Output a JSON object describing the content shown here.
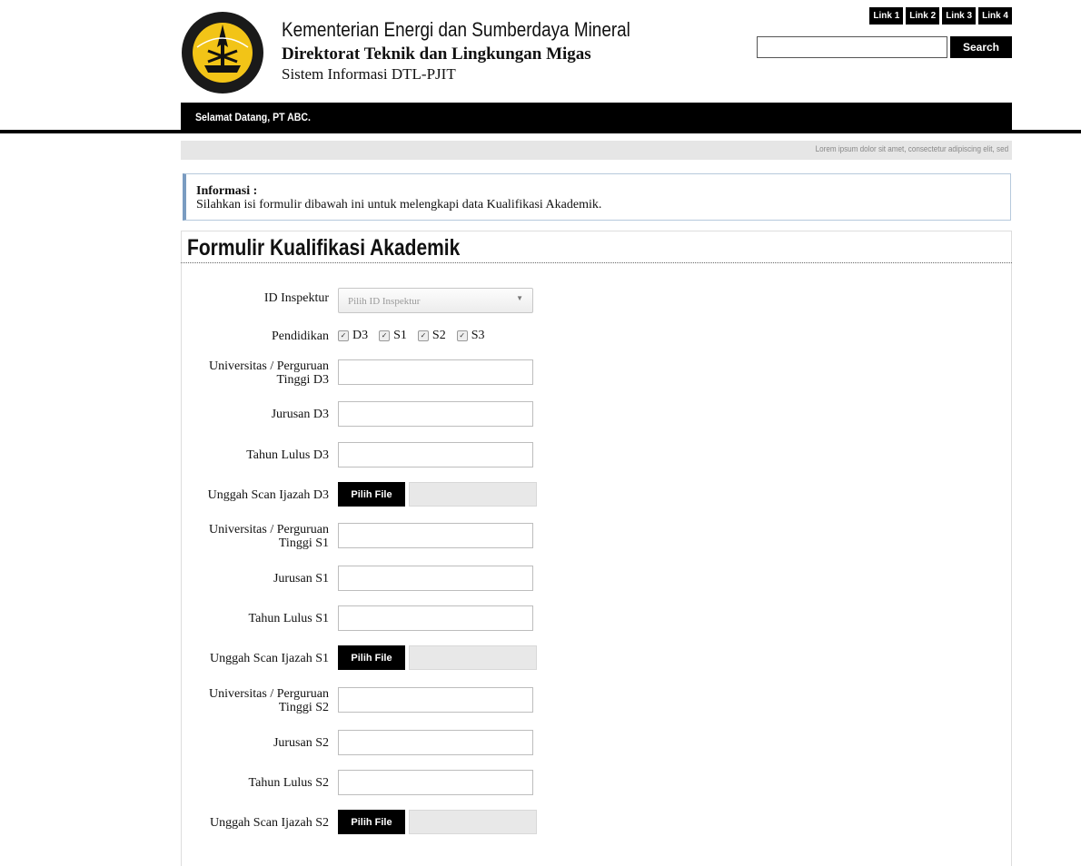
{
  "header": {
    "org_name": "Kementerian Energi dan Sumberdaya Mineral",
    "directorate": "Direktorat Teknik dan Lingkungan Migas",
    "system": "Sistem Informasi DTL-PJIT",
    "logo_text": "ENERGI DAN SUMBER DAYA MINERAL"
  },
  "top_links": [
    "Link 1",
    "Link 2",
    "Link 3",
    "Link 4"
  ],
  "search": {
    "button_label": "Search",
    "value": ""
  },
  "welcome": "Selamat Datang, PT ABC.",
  "tagline": "Lorem ipsum dolor sit amet, consectetur adipiscing elit, sed",
  "info": {
    "title": "Informasi :",
    "text": "Silahkan isi formulir dibawah ini untuk melengkapi data Kualifikasi Akademik."
  },
  "form": {
    "title": "Formulir Kualifikasi Akademik",
    "id_inspektur_label": "ID Inspektur",
    "id_inspektur_placeholder": "Pilih ID Inspektur",
    "pendidikan_label": "Pendidikan",
    "pendidikan_options": [
      "D3",
      "S1",
      "S2",
      "S3"
    ],
    "file_button_label": "Pilih File",
    "labels": {
      "univ_d3": "Universitas / Perguruan Tinggi D3",
      "jurusan_d3": "Jurusan D3",
      "tahun_d3": "Tahun Lulus D3",
      "scan_d3": "Unggah Scan Ijazah D3",
      "univ_s1": "Universitas / Perguruan Tinggi S1",
      "jurusan_s1": "Jurusan S1",
      "tahun_s1": "Tahun Lulus S1",
      "scan_s1": "Unggah Scan Ijazah S1",
      "univ_s2": "Universitas / Perguruan Tinggi S2",
      "jurusan_s2": "Jurusan S2",
      "tahun_s2": "Tahun Lulus S2",
      "scan_s2": "Unggah Scan Ijazah S2"
    }
  },
  "colors": {
    "accent": "#000000",
    "info_border": "#7a9cc1"
  }
}
